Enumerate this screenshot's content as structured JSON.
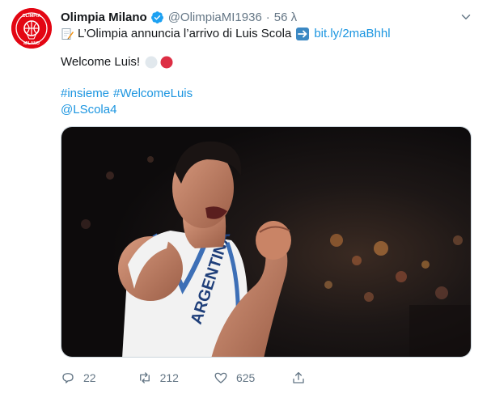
{
  "tweet": {
    "author_name": "Olimpia Milano",
    "handle": "@OlimpiaMI1936",
    "separator": "·",
    "time": "56 λ",
    "line1_text": "L’Olimpia annuncia l’arrivo di Luis Scola",
    "line1_link": "bit.ly/2maBhhl",
    "line2_text": "Welcome Luis!",
    "hashtag1": "#insieme",
    "hashtag2": "#WelcomeLuis",
    "mention": "@LScola4",
    "avatar_text_top": "OLIMPIA",
    "avatar_text_bottom": "MILANO",
    "jersey_text": "ARGENTINA"
  },
  "actions": {
    "replies": "22",
    "retweets": "212",
    "likes": "625"
  },
  "colors": {
    "link": "#1b95e0",
    "muted": "#657786",
    "verified": "#1da1f2",
    "brand_red": "#e30613"
  },
  "icons": [
    "verified-badge-icon",
    "chevron-down-icon",
    "memo-icon",
    "right-arrow-icon",
    "white-circle-icon",
    "red-circle-icon",
    "reply-icon",
    "retweet-icon",
    "like-icon",
    "share-icon"
  ]
}
